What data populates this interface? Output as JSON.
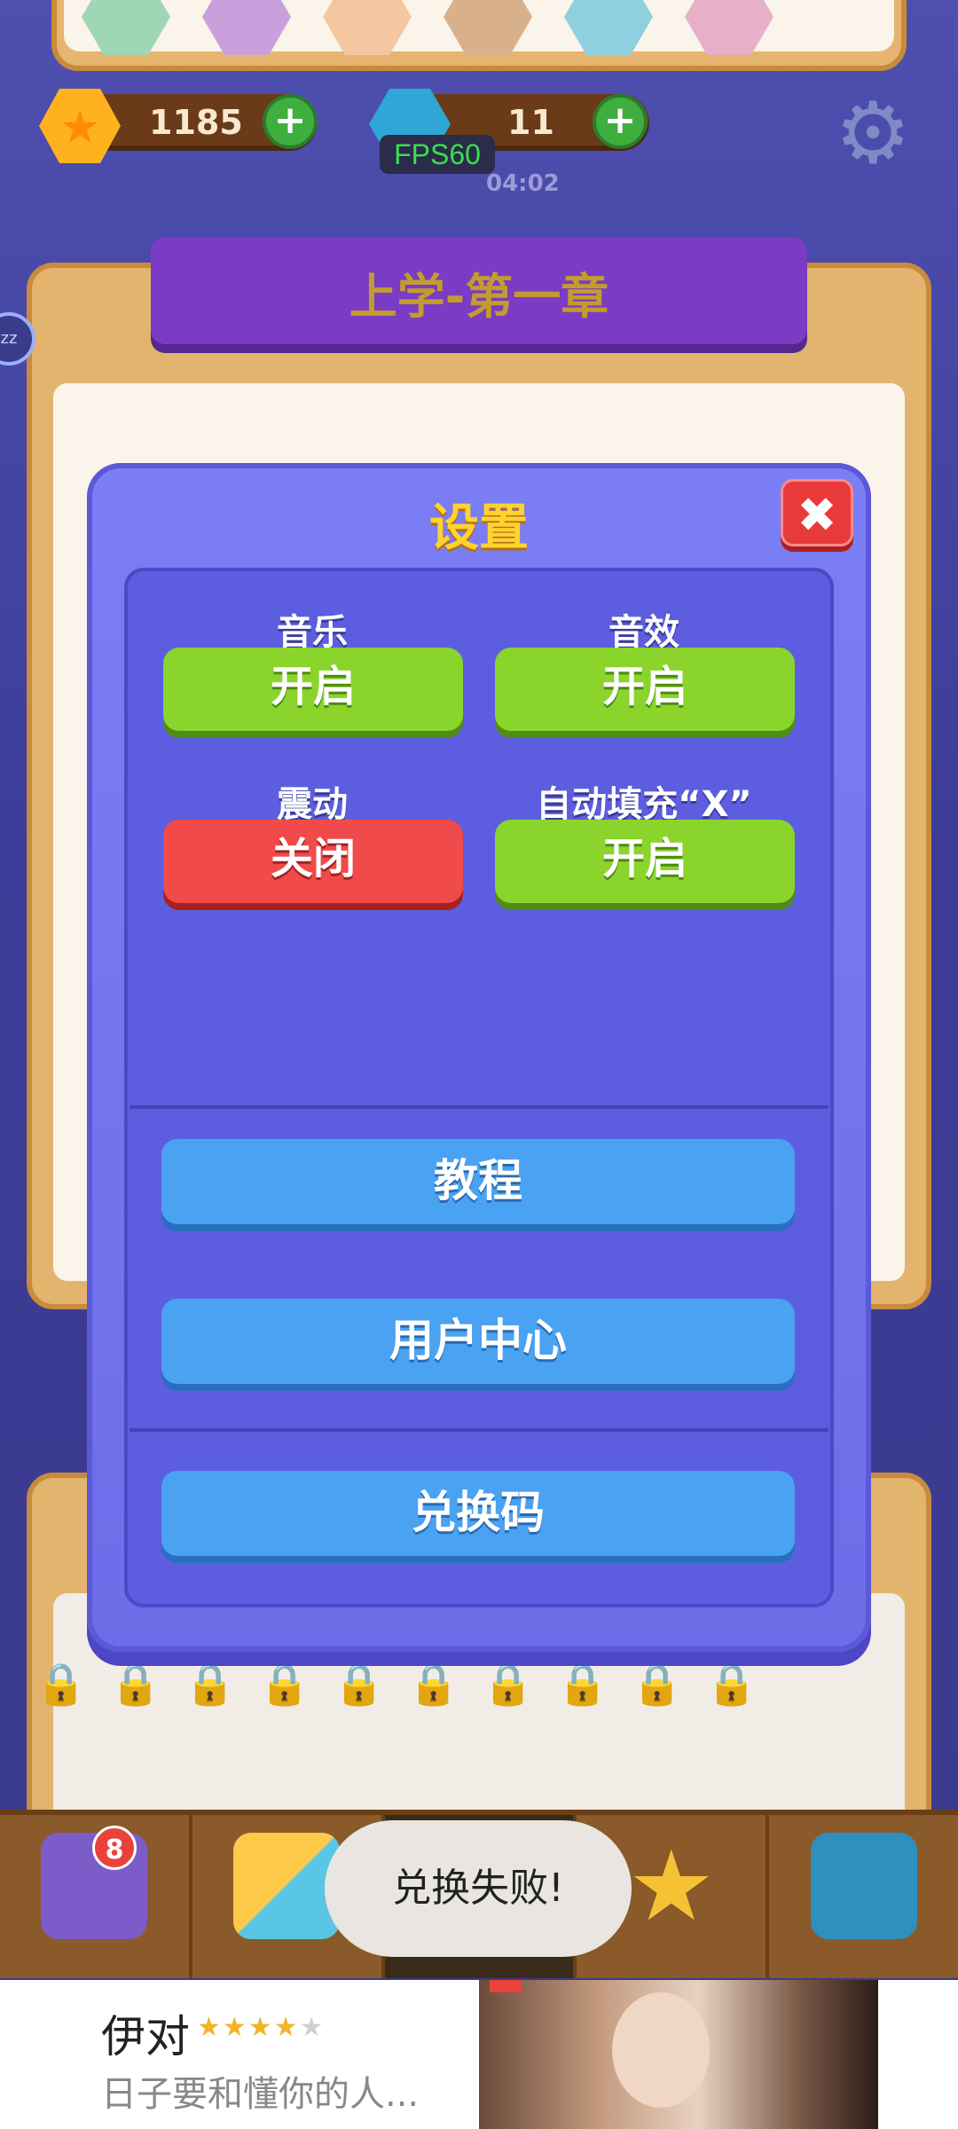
{
  "hud": {
    "stars": "1185",
    "gems": "11",
    "fps": "FPS60",
    "timer": "04:02",
    "plus": "+"
  },
  "chapter": {
    "title": "上学-第一章"
  },
  "settings": {
    "title": "设置",
    "close_icon": "✖",
    "music": {
      "label": "音乐",
      "state": "开启"
    },
    "sound": {
      "label": "音效",
      "state": "开启"
    },
    "vibration": {
      "label": "震动",
      "state": "关闭"
    },
    "autofill": {
      "label": "自动填充“X”",
      "state": "开启"
    },
    "tutorial": "教程",
    "user_center": "用户中心",
    "redeem_code": "兑换码"
  },
  "toast": "兑换失败!",
  "bottom_nav": {
    "shop_badge": "8"
  },
  "ad": {
    "title": "伊对",
    "rating_stars": "★★★★",
    "rating_empty": "★",
    "subtitle": "日子要和懂你的人..."
  },
  "colors": {
    "accent_green": "#8ad42c",
    "accent_red": "#f04a4a",
    "accent_blue": "#4aa2f2",
    "modal_purple": "#6c6de8",
    "title_gold": "#ffd22e"
  },
  "icons": {
    "star": "star-icon",
    "gem": "gem-icon",
    "gear": "gear-icon",
    "close": "close-icon",
    "lock": "lock-icon"
  }
}
